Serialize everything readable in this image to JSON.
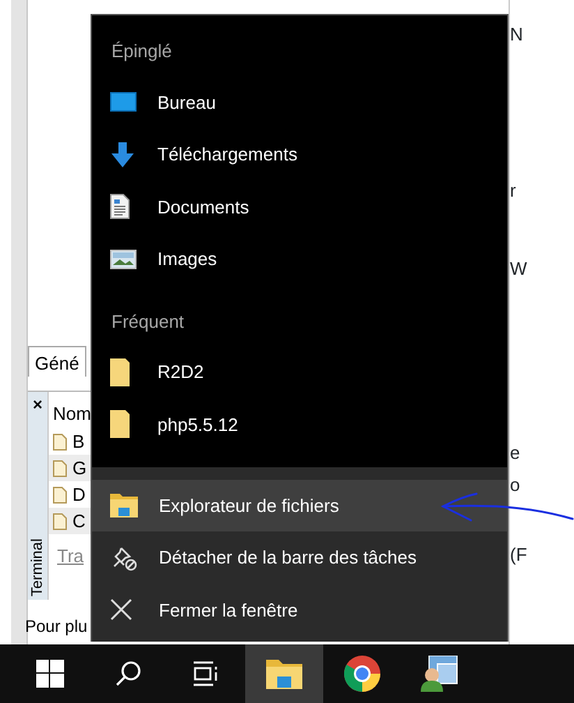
{
  "background_window": {
    "tab": "Géné",
    "panel": {
      "close": "×",
      "side_tab": "Terminal",
      "column_header": "Nom",
      "rows": [
        "B",
        "G",
        "D",
        "C"
      ],
      "footer_tab": "Tra"
    },
    "status_bar": "Pour plu",
    "right_edge": [
      "N",
      "r",
      "W",
      "e",
      "o",
      "(F"
    ]
  },
  "jump_list": {
    "sections": [
      {
        "title": "Épinglé",
        "items": [
          {
            "label": "Bureau",
            "kind": "desktop"
          },
          {
            "label": "Téléchargements",
            "kind": "download"
          },
          {
            "label": "Documents",
            "kind": "document"
          },
          {
            "label": "Images",
            "kind": "image"
          }
        ]
      },
      {
        "title": "Fréquent",
        "items": [
          {
            "label": "R2D2",
            "kind": "folder"
          },
          {
            "label": "php5.5.12",
            "kind": "folder"
          }
        ]
      }
    ],
    "tasks": [
      {
        "label": "Explorateur de fichiers",
        "kind": "explorer",
        "selected": true
      },
      {
        "label": "Détacher de la barre des tâches",
        "kind": "unpin",
        "selected": false
      },
      {
        "label": "Fermer la fenêtre",
        "kind": "close",
        "selected": false
      }
    ]
  },
  "taskbar": [
    {
      "kind": "start",
      "selected": false
    },
    {
      "kind": "search",
      "selected": false
    },
    {
      "kind": "task-view",
      "selected": false
    },
    {
      "kind": "explorer",
      "selected": true
    },
    {
      "kind": "chrome",
      "selected": false
    },
    {
      "kind": "admin",
      "selected": false
    }
  ]
}
